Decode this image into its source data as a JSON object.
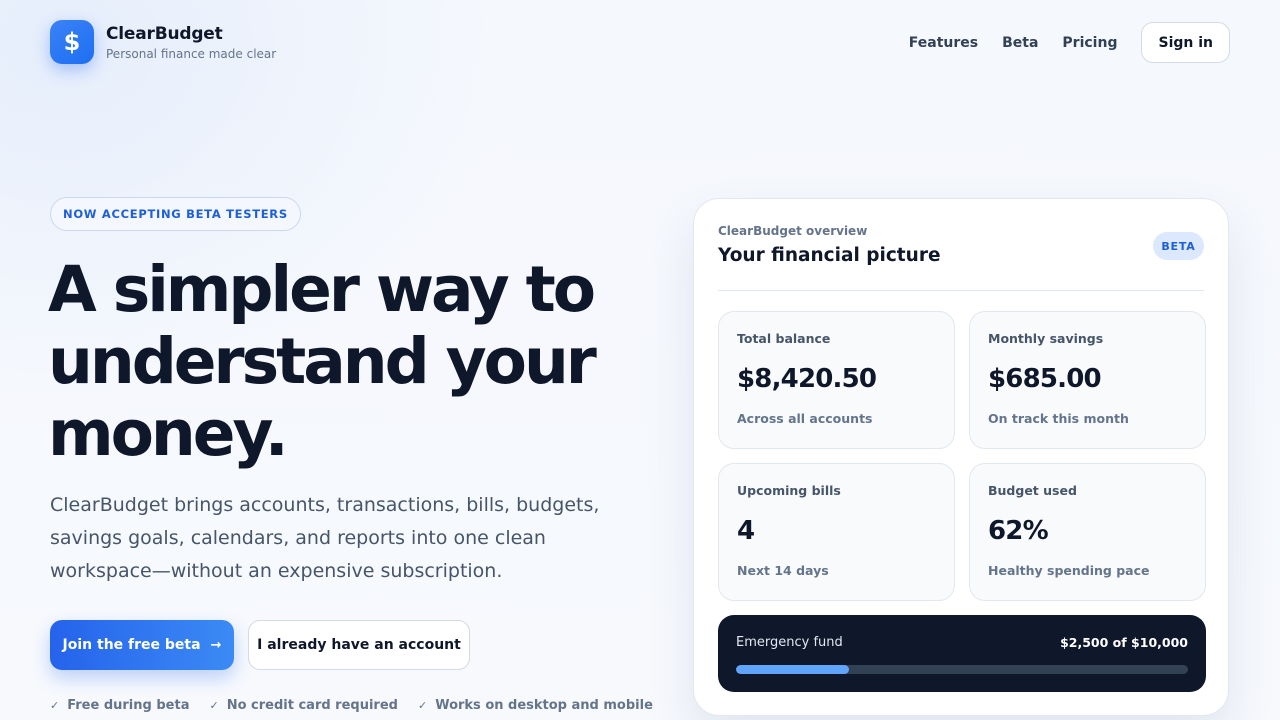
{
  "brand": {
    "logo_glyph": "$",
    "name": "ClearBudget",
    "tagline": "Personal finance made clear"
  },
  "nav": {
    "links": [
      "Features",
      "Beta",
      "Pricing"
    ],
    "signin_label": "Sign in"
  },
  "hero": {
    "pill": "NOW ACCEPTING BETA TESTERS",
    "headline": "A simpler way to understand your money.",
    "subtext": "ClearBudget brings accounts, transactions, bills, budgets, savings goals, calendars, and reports into one clean workspace—without an expensive subscription.",
    "primary_cta": "Join the free beta",
    "primary_cta_icon": "arrow-right-icon",
    "secondary_cta": "I already have an account",
    "perks": [
      "Free during beta",
      "No credit card required",
      "Works on desktop and mobile"
    ]
  },
  "card": {
    "kicker": "ClearBudget overview",
    "title": "Your financial picture",
    "badge": "BETA",
    "stats": [
      {
        "label": "Total balance",
        "value": "$8,420.50",
        "note": "Across all accounts"
      },
      {
        "label": "Monthly savings",
        "value": "$685.00",
        "note": "On track this month"
      },
      {
        "label": "Upcoming bills",
        "value": "4",
        "note": "Next 14 days"
      },
      {
        "label": "Budget used",
        "value": "62%",
        "note": "Healthy spending pace"
      }
    ],
    "fund": {
      "label": "Emergency fund",
      "amount": "$2,500 of $10,000",
      "progress": 0.25
    }
  },
  "colors": {
    "accent": "#2563eb",
    "dark_panel": "#0f172a",
    "progress_fill": "#60a5fa"
  }
}
